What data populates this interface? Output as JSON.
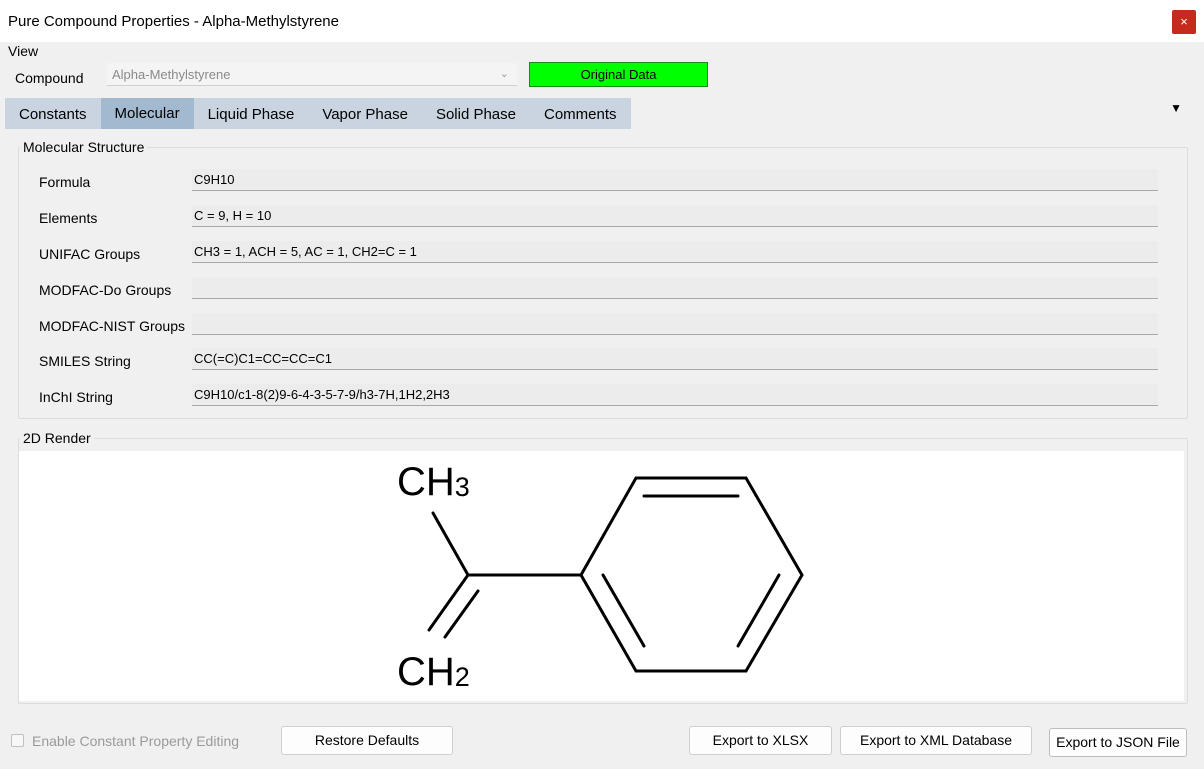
{
  "window": {
    "title": "Pure Compound Properties - Alpha-Methylstyrene",
    "close_glyph": "×"
  },
  "menu": {
    "view": "View"
  },
  "compound": {
    "label": "Compound",
    "selected": "Alpha-Methylstyrene",
    "status": "Original Data",
    "status_color": "#00ff00"
  },
  "tabs": [
    {
      "label": "Constants"
    },
    {
      "label": "Molecular"
    },
    {
      "label": "Liquid Phase"
    },
    {
      "label": "Vapor Phase"
    },
    {
      "label": "Solid Phase"
    },
    {
      "label": "Comments"
    }
  ],
  "active_tab": "Molecular",
  "molecular_structure": {
    "title": "Molecular Structure",
    "rows": [
      {
        "label": "Formula",
        "value": "C9H10"
      },
      {
        "label": "Elements",
        "value": "C = 9, H = 10"
      },
      {
        "label": "UNIFAC Groups",
        "value": "CH3 = 1, ACH = 5, AC = 1, CH2=C = 1"
      },
      {
        "label": "MODFAC-Do Groups",
        "value": ""
      },
      {
        "label": "MODFAC-NIST Groups",
        "value": ""
      },
      {
        "label": "SMILES String",
        "value": "CC(=C)C1=CC=CC=C1"
      },
      {
        "label": "InChI String",
        "value": "C9H10/c1-8(2)9-6-4-3-5-7-9/h3-7H,1H2,2H3"
      }
    ]
  },
  "render": {
    "title": "2D Render",
    "ch3_main": "CH",
    "ch3_sub": "3",
    "ch2_main": "CH",
    "ch2_sub": "2"
  },
  "footer": {
    "enable_editing": "Enable Constant Property Editing",
    "restore": "Restore Defaults",
    "export_xlsx": "Export to XLSX",
    "export_xml": "Export to XML Database",
    "export_json": "Export to JSON File"
  }
}
